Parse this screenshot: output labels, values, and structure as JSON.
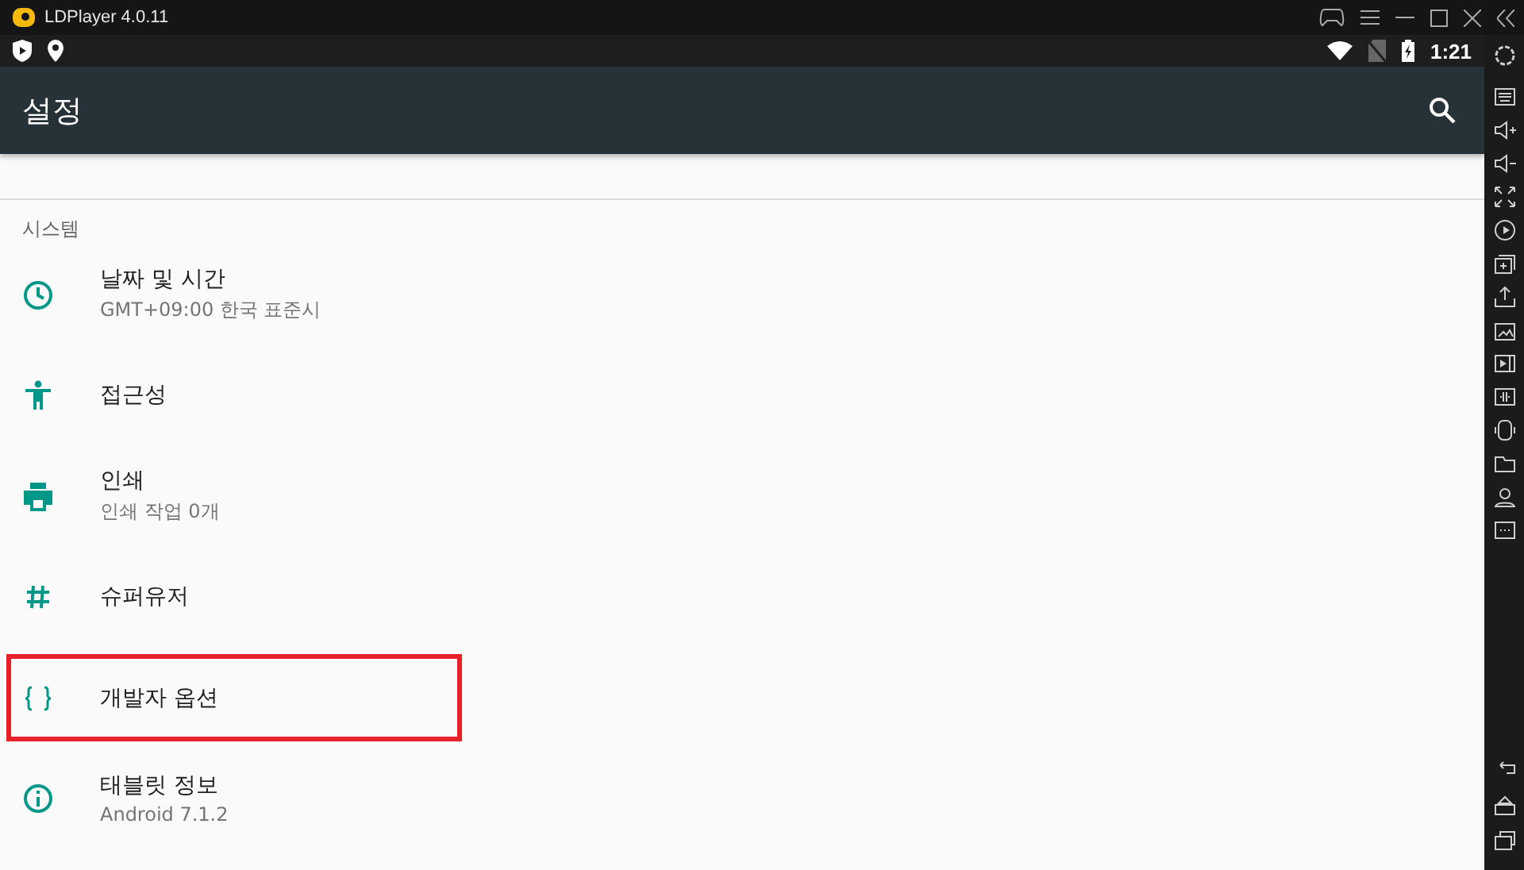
{
  "window": {
    "title": "LDPlayer 4.0.11"
  },
  "status_bar": {
    "time": "1:21"
  },
  "toolbar": {
    "title": "설정"
  },
  "section": {
    "title": "시스템"
  },
  "items": [
    {
      "title": "날짜 및 시간",
      "subtitle": "GMT+09:00 한국 표준시",
      "highlighted": false
    },
    {
      "title": "접근성",
      "highlighted": false
    },
    {
      "title": "인쇄",
      "subtitle": "인쇄 작업 0개",
      "highlighted": false
    },
    {
      "title": "슈퍼유저",
      "highlighted": false
    },
    {
      "title": "개발자 옵션",
      "highlighted": true
    },
    {
      "title": "태블릿 정보",
      "subtitle": "Android 7.1.2",
      "highlighted": false
    }
  ]
}
